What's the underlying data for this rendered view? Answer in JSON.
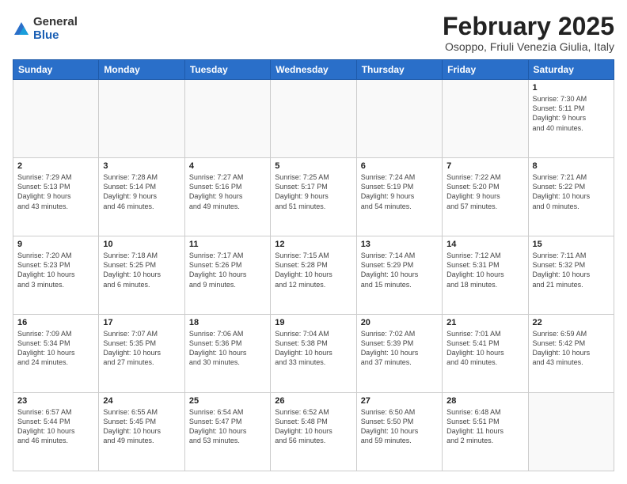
{
  "logo": {
    "general": "General",
    "blue": "Blue"
  },
  "title": "February 2025",
  "subtitle": "Osoppo, Friuli Venezia Giulia, Italy",
  "headers": [
    "Sunday",
    "Monday",
    "Tuesday",
    "Wednesday",
    "Thursday",
    "Friday",
    "Saturday"
  ],
  "weeks": [
    [
      {
        "day": "",
        "info": ""
      },
      {
        "day": "",
        "info": ""
      },
      {
        "day": "",
        "info": ""
      },
      {
        "day": "",
        "info": ""
      },
      {
        "day": "",
        "info": ""
      },
      {
        "day": "",
        "info": ""
      },
      {
        "day": "1",
        "info": "Sunrise: 7:30 AM\nSunset: 5:11 PM\nDaylight: 9 hours\nand 40 minutes."
      }
    ],
    [
      {
        "day": "2",
        "info": "Sunrise: 7:29 AM\nSunset: 5:13 PM\nDaylight: 9 hours\nand 43 minutes."
      },
      {
        "day": "3",
        "info": "Sunrise: 7:28 AM\nSunset: 5:14 PM\nDaylight: 9 hours\nand 46 minutes."
      },
      {
        "day": "4",
        "info": "Sunrise: 7:27 AM\nSunset: 5:16 PM\nDaylight: 9 hours\nand 49 minutes."
      },
      {
        "day": "5",
        "info": "Sunrise: 7:25 AM\nSunset: 5:17 PM\nDaylight: 9 hours\nand 51 minutes."
      },
      {
        "day": "6",
        "info": "Sunrise: 7:24 AM\nSunset: 5:19 PM\nDaylight: 9 hours\nand 54 minutes."
      },
      {
        "day": "7",
        "info": "Sunrise: 7:22 AM\nSunset: 5:20 PM\nDaylight: 9 hours\nand 57 minutes."
      },
      {
        "day": "8",
        "info": "Sunrise: 7:21 AM\nSunset: 5:22 PM\nDaylight: 10 hours\nand 0 minutes."
      }
    ],
    [
      {
        "day": "9",
        "info": "Sunrise: 7:20 AM\nSunset: 5:23 PM\nDaylight: 10 hours\nand 3 minutes."
      },
      {
        "day": "10",
        "info": "Sunrise: 7:18 AM\nSunset: 5:25 PM\nDaylight: 10 hours\nand 6 minutes."
      },
      {
        "day": "11",
        "info": "Sunrise: 7:17 AM\nSunset: 5:26 PM\nDaylight: 10 hours\nand 9 minutes."
      },
      {
        "day": "12",
        "info": "Sunrise: 7:15 AM\nSunset: 5:28 PM\nDaylight: 10 hours\nand 12 minutes."
      },
      {
        "day": "13",
        "info": "Sunrise: 7:14 AM\nSunset: 5:29 PM\nDaylight: 10 hours\nand 15 minutes."
      },
      {
        "day": "14",
        "info": "Sunrise: 7:12 AM\nSunset: 5:31 PM\nDaylight: 10 hours\nand 18 minutes."
      },
      {
        "day": "15",
        "info": "Sunrise: 7:11 AM\nSunset: 5:32 PM\nDaylight: 10 hours\nand 21 minutes."
      }
    ],
    [
      {
        "day": "16",
        "info": "Sunrise: 7:09 AM\nSunset: 5:34 PM\nDaylight: 10 hours\nand 24 minutes."
      },
      {
        "day": "17",
        "info": "Sunrise: 7:07 AM\nSunset: 5:35 PM\nDaylight: 10 hours\nand 27 minutes."
      },
      {
        "day": "18",
        "info": "Sunrise: 7:06 AM\nSunset: 5:36 PM\nDaylight: 10 hours\nand 30 minutes."
      },
      {
        "day": "19",
        "info": "Sunrise: 7:04 AM\nSunset: 5:38 PM\nDaylight: 10 hours\nand 33 minutes."
      },
      {
        "day": "20",
        "info": "Sunrise: 7:02 AM\nSunset: 5:39 PM\nDaylight: 10 hours\nand 37 minutes."
      },
      {
        "day": "21",
        "info": "Sunrise: 7:01 AM\nSunset: 5:41 PM\nDaylight: 10 hours\nand 40 minutes."
      },
      {
        "day": "22",
        "info": "Sunrise: 6:59 AM\nSunset: 5:42 PM\nDaylight: 10 hours\nand 43 minutes."
      }
    ],
    [
      {
        "day": "23",
        "info": "Sunrise: 6:57 AM\nSunset: 5:44 PM\nDaylight: 10 hours\nand 46 minutes."
      },
      {
        "day": "24",
        "info": "Sunrise: 6:55 AM\nSunset: 5:45 PM\nDaylight: 10 hours\nand 49 minutes."
      },
      {
        "day": "25",
        "info": "Sunrise: 6:54 AM\nSunset: 5:47 PM\nDaylight: 10 hours\nand 53 minutes."
      },
      {
        "day": "26",
        "info": "Sunrise: 6:52 AM\nSunset: 5:48 PM\nDaylight: 10 hours\nand 56 minutes."
      },
      {
        "day": "27",
        "info": "Sunrise: 6:50 AM\nSunset: 5:50 PM\nDaylight: 10 hours\nand 59 minutes."
      },
      {
        "day": "28",
        "info": "Sunrise: 6:48 AM\nSunset: 5:51 PM\nDaylight: 11 hours\nand 2 minutes."
      },
      {
        "day": "",
        "info": ""
      }
    ]
  ]
}
